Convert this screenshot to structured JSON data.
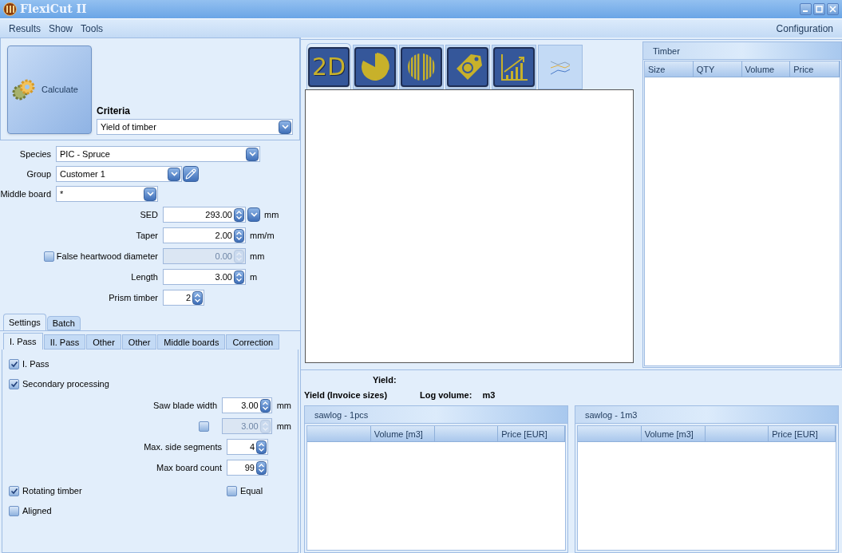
{
  "window": {
    "title": "FlexiCut II"
  },
  "menu": {
    "left": [
      {
        "label": "Results"
      },
      {
        "label": "Show"
      },
      {
        "label": "Tools"
      }
    ],
    "right": [
      {
        "label": "Configuration"
      }
    ]
  },
  "calculate": {
    "label": "Calculate"
  },
  "criteria": {
    "label": "Criteria",
    "value": "Yield of timber"
  },
  "selects": [
    {
      "label": "Species",
      "value": "PIC - Spruce",
      "kind": "wide"
    },
    {
      "label": "Group",
      "value": "Customer 1",
      "kind": "edit"
    },
    {
      "label": "Middle board",
      "value": "*",
      "kind": "short"
    }
  ],
  "numbers": [
    {
      "label": "SED",
      "value": "293.00",
      "unit": "mm",
      "kind": "spin-dropdown",
      "disabled": false
    },
    {
      "label": "Taper",
      "value": "2.00",
      "unit": "mm/m",
      "kind": "spin",
      "disabled": false
    },
    {
      "label": "False heartwood diameter",
      "value": "0.00",
      "unit": "mm",
      "kind": "check-spin",
      "checked": false,
      "disabled": true
    },
    {
      "label": "Length",
      "value": "3.00",
      "unit": "m",
      "kind": "spin",
      "disabled": false
    },
    {
      "label": "Prism timber",
      "value": "2",
      "kind": "small-spin",
      "disabled": false
    }
  ],
  "outer_tabs": [
    {
      "label": "Settings",
      "selected": true
    },
    {
      "label": "Batch",
      "selected": false
    }
  ],
  "inner_tabs": [
    {
      "label": "I. Pass",
      "selected": true
    },
    {
      "label": "II. Pass",
      "selected": false
    },
    {
      "label": "Other",
      "selected": false
    },
    {
      "label": "Other",
      "selected": false
    },
    {
      "label": "Middle boards",
      "selected": false
    },
    {
      "label": "Correction",
      "selected": false
    }
  ],
  "settings": {
    "top_checks": [
      {
        "label": "I. Pass",
        "checked": true
      },
      {
        "label": "Secondary processing",
        "checked": true
      }
    ],
    "numbers": [
      {
        "label": "Saw blade width",
        "value": "3.00",
        "unit": "mm",
        "kind": "wide",
        "disabled": false
      },
      {
        "kind": "check-wide",
        "checked": false,
        "value": "3.00",
        "unit": "mm",
        "disabled": true
      },
      {
        "label": "Max. side segments",
        "value": "4",
        "kind": "short",
        "disabled": false
      },
      {
        "label": "Max board count",
        "value": "99",
        "kind": "short",
        "disabled": false
      }
    ],
    "rotating": {
      "label": "Rotating timber",
      "checked": true
    },
    "equal": {
      "label": "Equal",
      "checked": false
    },
    "aligned": {
      "label": "Aligned",
      "checked": false
    }
  },
  "view_tabs": [
    {
      "kind": "plan",
      "label": "2D",
      "selected": true
    },
    {
      "kind": "pie",
      "selected": false
    },
    {
      "kind": "stripes",
      "selected": false
    },
    {
      "kind": "price",
      "selected": false
    },
    {
      "kind": "growth",
      "selected": false
    },
    {
      "kind": "lines",
      "selected": false
    }
  ],
  "timber": {
    "title": "Timber",
    "columns": [
      "Size",
      "QTY",
      "Volume",
      "Price"
    ]
  },
  "yield": {
    "yield_label": "Yield:",
    "invoice_label": "Yield (Invoice sizes)",
    "log_volume_label": "Log volume:",
    "log_volume_unit": "m3"
  },
  "sawlog_tables": [
    {
      "title": "sawlog - 1pcs",
      "columns": [
        {},
        {
          "label": "Volume [m3]"
        },
        {},
        {
          "label": "Price [EUR]"
        }
      ]
    },
    {
      "title": "sawlog - 1m3",
      "columns": [
        {},
        {
          "label": "Volume [m3]"
        },
        {},
        {
          "label": "Price [EUR]"
        }
      ]
    }
  ]
}
